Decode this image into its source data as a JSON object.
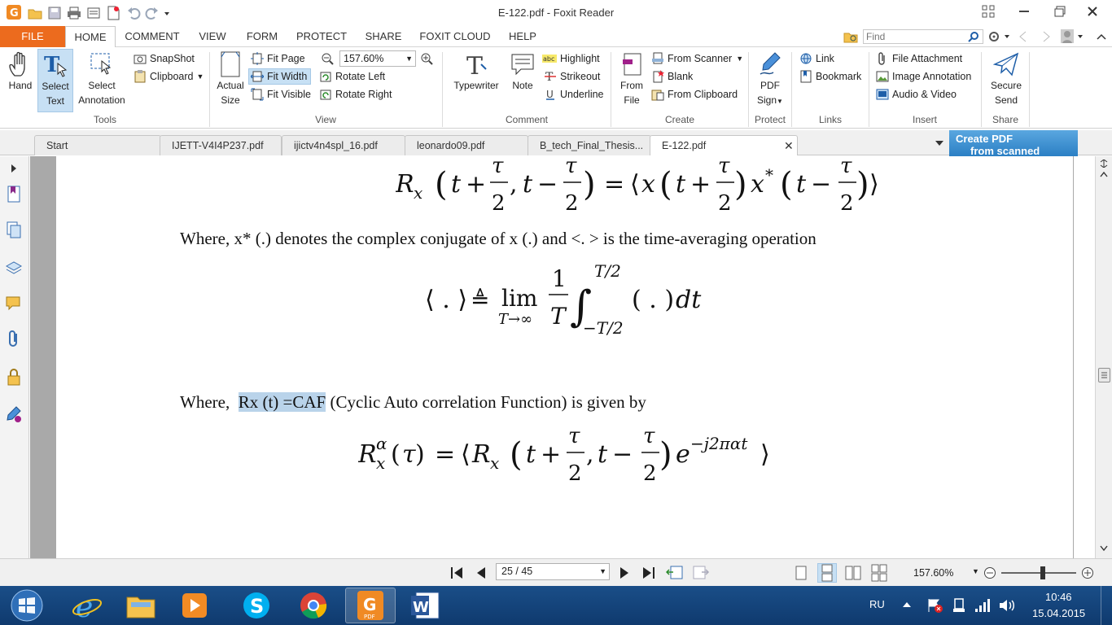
{
  "window": {
    "title": "E-122.pdf - Foxit Reader"
  },
  "ribbon_tabs": [
    "FILE",
    "HOME",
    "COMMENT",
    "VIEW",
    "FORM",
    "PROTECT",
    "SHARE",
    "FOXIT CLOUD",
    "HELP"
  ],
  "find": {
    "placeholder": "Find"
  },
  "tools": {
    "hand": "Hand",
    "select_text_1": "Select",
    "select_text_2": "Text",
    "select_annot_1": "Select",
    "select_annot_2": "Annotation",
    "snapshot": "SnapShot",
    "clipboard": "Clipboard",
    "group": "Tools"
  },
  "view": {
    "actual_size_1": "Actual",
    "actual_size_2": "Size",
    "fit_page": "Fit Page",
    "fit_width": "Fit Width",
    "fit_visible": "Fit Visible",
    "zoom": "157.60%",
    "rotate_left": "Rotate Left",
    "rotate_right": "Rotate Right",
    "group": "View"
  },
  "comment": {
    "typewriter": "Typewriter",
    "note": "Note",
    "highlight": "Highlight",
    "strikeout": "Strikeout",
    "underline": "Underline",
    "group": "Comment"
  },
  "create": {
    "from_file_1": "From",
    "from_file_2": "File",
    "from_scanner": "From Scanner",
    "blank": "Blank",
    "from_clipboard": "From Clipboard",
    "group": "Create"
  },
  "protect": {
    "pdf_sign_1": "PDF",
    "pdf_sign_2": "Sign",
    "group": "Protect"
  },
  "links": {
    "link": "Link",
    "bookmark": "Bookmark",
    "group": "Links"
  },
  "insert": {
    "file_attachment": "File Attachment",
    "image_annotation": "Image Annotation",
    "audio_video": "Audio & Video",
    "group": "Insert"
  },
  "share": {
    "secure_send_1": "Secure",
    "secure_send_2": "Send",
    "group": "Share"
  },
  "doc_tabs": [
    "Start",
    "IJETT-V4I4P237.pdf",
    "ijictv4n4spl_16.pdf",
    "leonardo09.pdf",
    "B_tech_Final_Thesis...",
    "E-122.pdf"
  ],
  "ad": {
    "line1": "Create PDF",
    "line2": "from scanned docum"
  },
  "document": {
    "para1": "Where, x* (.) denotes the complex conjugate of x (.) and <. > is the time-averaging operation",
    "para2_prefix": "Where,  ",
    "para2_highlight": "Rx (t) =CAF",
    "para2_suffix": " (Cyclic Auto correlation Function) is given by"
  },
  "status": {
    "page": "25 / 45",
    "zoom": "157.60%"
  },
  "taskbar": {
    "lang": "RU",
    "time": "10:46",
    "date": "15.04.2015"
  }
}
